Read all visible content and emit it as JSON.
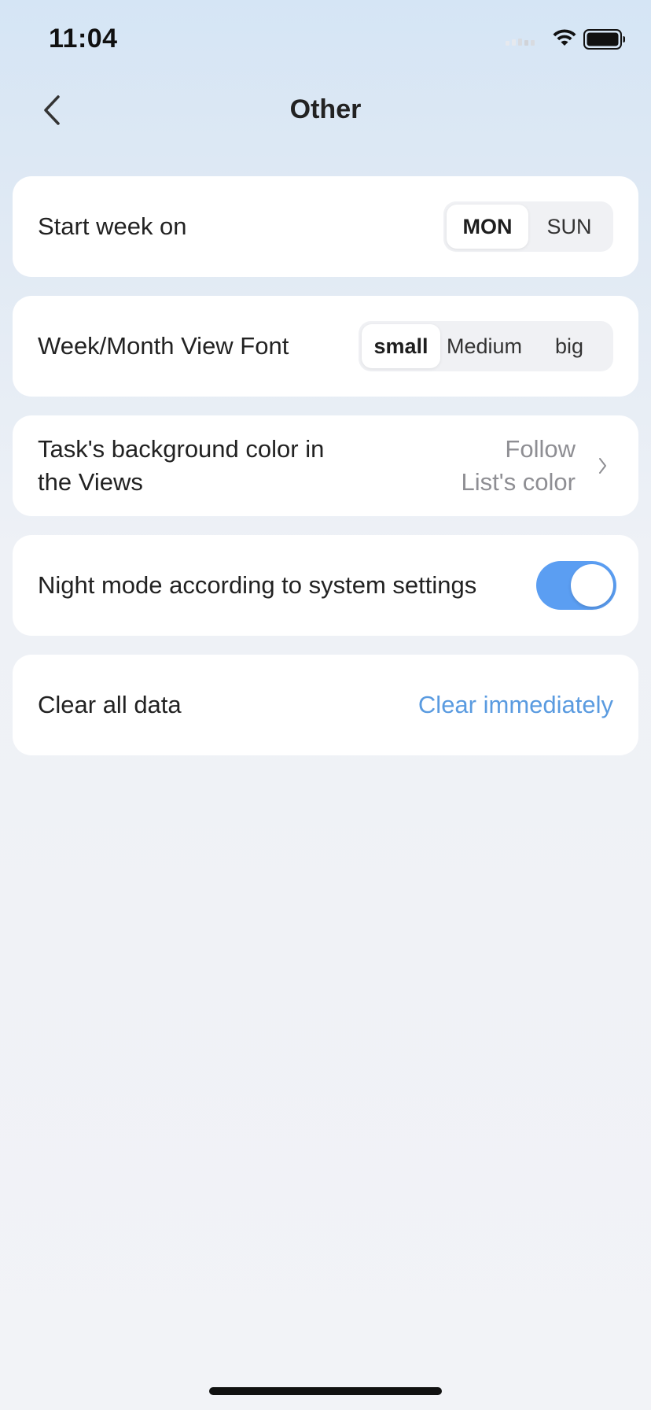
{
  "status_bar": {
    "time": "11:04"
  },
  "header": {
    "title": "Other"
  },
  "settings": {
    "start_week": {
      "label": "Start week on",
      "options": [
        "MON",
        "SUN"
      ],
      "selected": "MON"
    },
    "view_font": {
      "label": "Week/Month View Font",
      "options": [
        "small",
        "Medium",
        "big"
      ],
      "selected": "small"
    },
    "task_bg_color": {
      "label_line1": "Task's background color in",
      "label_line2": "the Views",
      "value_line1": "Follow",
      "value_line2": "List's color",
      "chevron_icon": "chevron-right-icon"
    },
    "night_mode": {
      "label": "Night mode according to system settings",
      "enabled": true
    },
    "clear_data": {
      "label": "Clear all data",
      "action": "Clear immediately"
    }
  },
  "colors": {
    "accent": "#5b9ef2",
    "link": "#5a9be0",
    "secondary_text": "#8e8e93"
  }
}
